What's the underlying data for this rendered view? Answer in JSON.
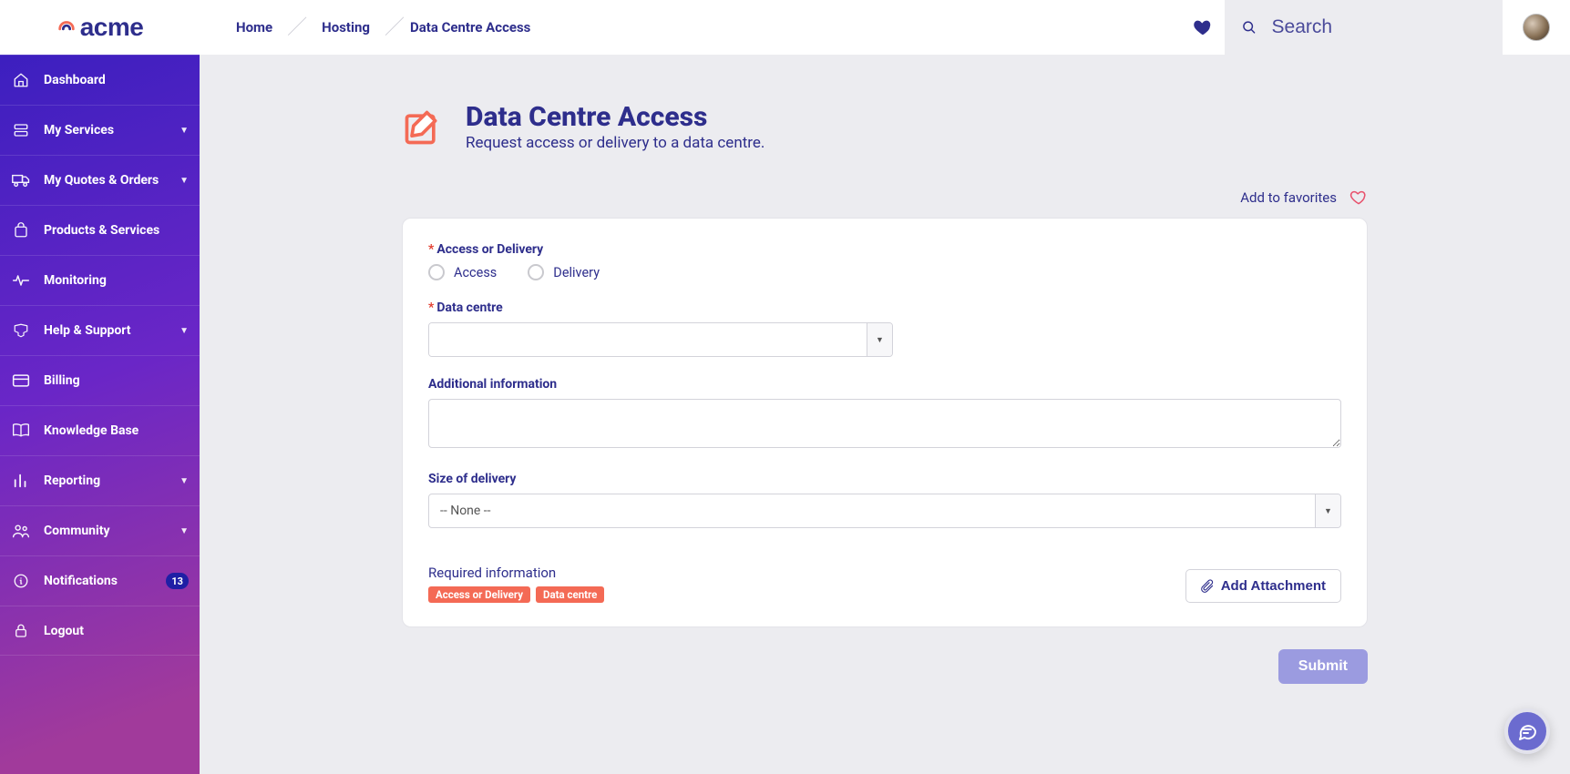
{
  "brand": {
    "name": "acme"
  },
  "breadcrumbs": {
    "items": [
      {
        "label": "Home",
        "link": true
      },
      {
        "label": "Hosting",
        "link": true
      },
      {
        "label": "Data Centre Access",
        "link": false
      }
    ]
  },
  "search": {
    "placeholder": "Search"
  },
  "sidebar": {
    "items": [
      {
        "id": "dashboard",
        "label": "Dashboard",
        "icon": "home",
        "expandable": false
      },
      {
        "id": "my-services",
        "label": "My Services",
        "icon": "services",
        "expandable": true
      },
      {
        "id": "quotes-orders",
        "label": "My Quotes & Orders",
        "icon": "truck",
        "expandable": true
      },
      {
        "id": "products",
        "label": "Products & Services",
        "icon": "bag",
        "expandable": false
      },
      {
        "id": "monitoring",
        "label": "Monitoring",
        "icon": "pulse",
        "expandable": false
      },
      {
        "id": "help",
        "label": "Help & Support",
        "icon": "inbox",
        "expandable": true
      },
      {
        "id": "billing",
        "label": "Billing",
        "icon": "card",
        "expandable": false
      },
      {
        "id": "kb",
        "label": "Knowledge Base",
        "icon": "book",
        "expandable": false
      },
      {
        "id": "reporting",
        "label": "Reporting",
        "icon": "bars",
        "expandable": true
      },
      {
        "id": "community",
        "label": "Community",
        "icon": "people",
        "expandable": true
      },
      {
        "id": "notifications",
        "label": "Notifications",
        "icon": "info",
        "expandable": false,
        "badge": "13"
      },
      {
        "id": "logout",
        "label": "Logout",
        "icon": "lock",
        "expandable": false
      }
    ]
  },
  "page": {
    "title": "Data Centre Access",
    "subtitle": "Request access or delivery to a data centre.",
    "favorites_label": "Add to favorites"
  },
  "form": {
    "access_or_delivery": {
      "label": "Access or Delivery",
      "required": true,
      "options": {
        "access": "Access",
        "delivery": "Delivery"
      }
    },
    "data_centre": {
      "label": "Data centre",
      "required": true,
      "value": ""
    },
    "additional_info": {
      "label": "Additional information",
      "value": ""
    },
    "size_of_delivery": {
      "label": "Size of delivery",
      "value": "-- None --"
    },
    "required_info": {
      "label": "Required information",
      "chips": [
        "Access or Delivery",
        "Data centre"
      ]
    },
    "add_attachment_label": "Add Attachment",
    "submit_label": "Submit"
  },
  "colors": {
    "primary": "#2e2e8c",
    "accent": "#f46a55",
    "heart": "#e8516c",
    "submit": "#9b9be0"
  }
}
